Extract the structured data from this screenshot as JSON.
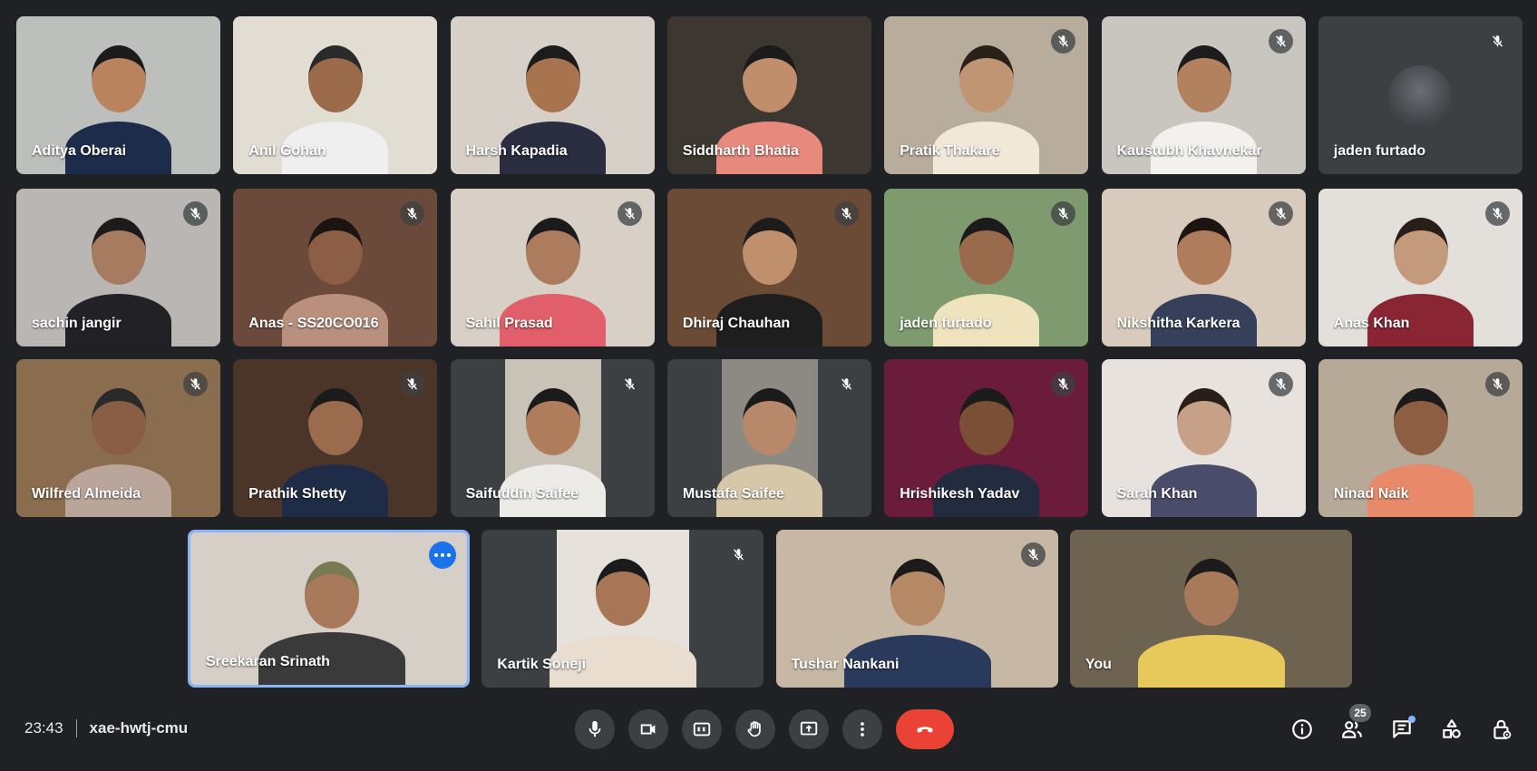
{
  "meeting": {
    "time": "23:43",
    "code": "xae-hwtj-cmu"
  },
  "participants": [
    {
      "name": "Aditya Oberai",
      "muted": false,
      "bg": "#bdbfbc",
      "skin": "#b8835d",
      "shirt": "#1d2c4a",
      "hair": "#1b1b1b"
    },
    {
      "name": "Anil Gohan",
      "muted": false,
      "bg": "#e2ddd2",
      "skin": "#9a6a4a",
      "shirt": "#efefef",
      "hair": "#2a2a2a"
    },
    {
      "name": "Harsh Kapadia",
      "muted": false,
      "bg": "#d7d0c9",
      "skin": "#a8734f",
      "shirt": "#2a2c3f",
      "hair": "#1c1c1c"
    },
    {
      "name": "Siddharth Bhatia",
      "muted": false,
      "bg": "#3c3731",
      "skin": "#c18e6b",
      "shirt": "#e8897d",
      "hair": "#1b1b1b"
    },
    {
      "name": "Pratik Thakare",
      "muted": true,
      "bg": "#b8ad9c",
      "skin": "#c09574",
      "shirt": "#f1e8da",
      "hair": "#2a2218"
    },
    {
      "name": "Kaustubh Khavnekar",
      "muted": true,
      "bg": "#c9c6c0",
      "skin": "#b2825e",
      "shirt": "#f3f1ee",
      "hair": "#1c1c1c"
    },
    {
      "name": "jaden furtado",
      "muted": true,
      "avatar": true,
      "bg": "#3c4043"
    },
    {
      "name": "sachin jangir",
      "muted": true,
      "bg": "#b9b6b4",
      "skin": "#a77b5f",
      "shirt": "#222226",
      "hair": "#1e1a1c"
    },
    {
      "name": "Anas - SS20CO016",
      "muted": true,
      "bg": "#6b4a3c",
      "skin": "#8b5e45",
      "shirt": "#b98f7e",
      "hair": "#1b1411"
    },
    {
      "name": "Sahil Prasad",
      "muted": true,
      "bg": "#d8cfc6",
      "skin": "#ad7c5f",
      "shirt": "#e05f6a",
      "hair": "#1b1b1b"
    },
    {
      "name": "Dhiraj Chauhan",
      "muted": true,
      "bg": "#6b4b35",
      "skin": "#c08f6b",
      "shirt": "#1e1e1e",
      "hair": "#1c1c1c"
    },
    {
      "name": "jaden furtado",
      "muted": true,
      "bg": "#7f9a6e",
      "skin": "#9a6a4c",
      "shirt": "#efe3bd",
      "hair": "#1b1b1b"
    },
    {
      "name": "Nikshitha Karkera",
      "muted": true,
      "bg": "#d8cbbd",
      "skin": "#b07d5c",
      "shirt": "#36405a",
      "hair": "#1b1411"
    },
    {
      "name": "Anas Khan",
      "muted": true,
      "bg": "#e3e0dc",
      "skin": "#c49a7c",
      "shirt": "#8a2633",
      "hair": "#2a1e18"
    },
    {
      "name": "Wilfred Almeida",
      "muted": true,
      "bg": "#8a6c4e",
      "skin": "#8a5e44",
      "shirt": "#b9a59a",
      "hair": "#2a2a2a"
    },
    {
      "name": "Prathik Shetty",
      "muted": true,
      "bg": "#4b3528",
      "skin": "#9a6c4d",
      "shirt": "#1f2c48",
      "hair": "#1b1b1b"
    },
    {
      "name": "Saifuddin Saifee",
      "muted": true,
      "bg": "#3c4043",
      "skin": "#b07d5c",
      "shirt": "#ecebe8",
      "hair": "#1b1b1b",
      "frame": "#c8c3b6"
    },
    {
      "name": "Mustafa Saifee",
      "muted": true,
      "bg": "#3c4043",
      "skin": "#b8886a",
      "shirt": "#d6c7a8",
      "hair": "#1b1b1b",
      "frame": "#8d8a84"
    },
    {
      "name": "Hrishikesh Yadav",
      "muted": true,
      "bg": "#6a1c3a",
      "skin": "#7a4f36",
      "shirt": "#232c3f",
      "hair": "#1b1b1b"
    },
    {
      "name": "Sarah Khan",
      "muted": true,
      "bg": "#e7e2de",
      "skin": "#c7a088",
      "shirt": "#4a4c6b",
      "hair": "#2a1e18"
    },
    {
      "name": "Ninad Naik",
      "muted": true,
      "bg": "#b7a998",
      "skin": "#8d5e42",
      "shirt": "#e88a6a",
      "hair": "#1b1b1b"
    },
    {
      "name": "Sreekaran Srinath",
      "muted": false,
      "speaking": true,
      "bg": "#d6cfc7",
      "skin": "#a9795b",
      "shirt": "#3a3a3a",
      "hair": "#7a7a52"
    },
    {
      "name": "Kartik Soneji",
      "muted": true,
      "bg": "#3c4043",
      "skin": "#a87656",
      "shirt": "#e9ddd0",
      "hair": "#1b1b1b",
      "frame": "#e6e1db"
    },
    {
      "name": "Tushar Nankani",
      "muted": true,
      "bg": "#c7b8a5",
      "skin": "#b58866",
      "shirt": "#2a3a5c",
      "hair": "#1b1b1b"
    },
    {
      "name": "You",
      "muted": false,
      "bg": "#6e6250",
      "skin": "#a87a5b",
      "shirt": "#e7c85a",
      "hair": "#1b1b1b"
    }
  ],
  "right_controls": {
    "people_count": "25"
  },
  "colors": {
    "background": "#202124",
    "control": "#3c4043",
    "end_call": "#ea4335",
    "accent": "#8ab4f8",
    "speaking_more": "#1a73e8"
  },
  "icons": {
    "mic": "mic-icon",
    "camera": "camera-icon",
    "captions": "captions-icon",
    "hand": "raise-hand-icon",
    "present": "present-icon",
    "more": "more-vert-icon",
    "end": "end-call-icon",
    "info": "info-icon",
    "people": "people-icon",
    "chat": "chat-icon",
    "activities": "activities-icon",
    "host": "host-controls-icon"
  }
}
